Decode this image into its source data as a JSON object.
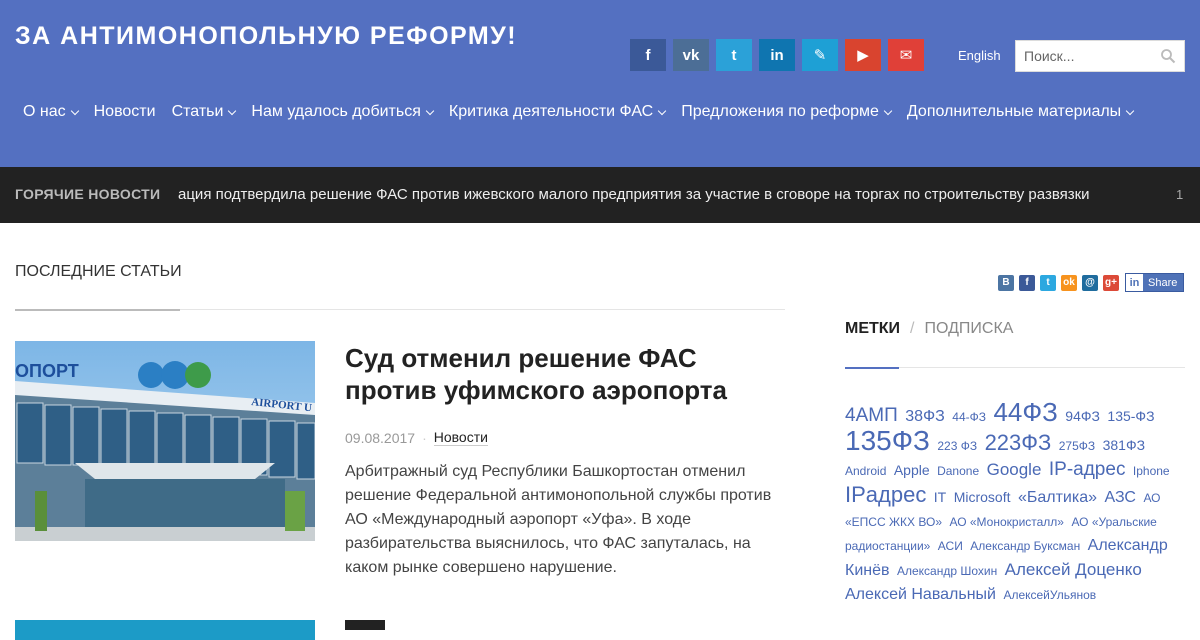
{
  "site": {
    "title": "ЗА АНТИМОНОПОЛЬНУЮ РЕФОРМУ!"
  },
  "social": [
    {
      "name": "facebook",
      "glyph": "f",
      "color": "#3b5998"
    },
    {
      "name": "vk",
      "glyph": "vk",
      "color": "#4c6e96"
    },
    {
      "name": "twitter",
      "glyph": "t",
      "color": "#2ba1d8"
    },
    {
      "name": "linkedin",
      "glyph": "in",
      "color": "#0f75b0"
    },
    {
      "name": "livejournal",
      "glyph": "✎",
      "color": "#1ea0d5"
    },
    {
      "name": "youtube",
      "glyph": "▶",
      "color": "#d9442f"
    },
    {
      "name": "email",
      "glyph": "✉",
      "color": "#e04038"
    }
  ],
  "header": {
    "lang": "English",
    "search_placeholder": "Поиск..."
  },
  "nav": [
    {
      "label": "О нас",
      "dropdown": true
    },
    {
      "label": "Новости",
      "dropdown": false
    },
    {
      "label": "Статьи",
      "dropdown": true
    },
    {
      "label": "Нам удалось добиться",
      "dropdown": true
    },
    {
      "label": "Критика деятельности ФАС",
      "dropdown": true
    },
    {
      "label": "Предложения по реформе",
      "dropdown": true
    },
    {
      "label": "Дополнительные материалы",
      "dropdown": true
    }
  ],
  "ticker": {
    "label": "ГОРЯЧИЕ НОВОСТИ",
    "text": "ация подтвердила решение ФАС против ижевского малого предприятия за участие в сговоре на торгах по строительству развязки",
    "next": "1"
  },
  "main": {
    "section_title": "ПОСЛЕДНИЕ СТАТЬИ",
    "share_label": "Share",
    "share_icons": [
      {
        "name": "vk",
        "glyph": "В",
        "color": "#4c75a3"
      },
      {
        "name": "facebook",
        "glyph": "f",
        "color": "#3b5998"
      },
      {
        "name": "twitter",
        "glyph": "t",
        "color": "#2ca8e0"
      },
      {
        "name": "odnoklassniki",
        "glyph": "ok",
        "color": "#f7931e"
      },
      {
        "name": "mailru",
        "glyph": "@",
        "color": "#1f6c9e"
      },
      {
        "name": "googleplus",
        "glyph": "g+",
        "color": "#dc4a38"
      }
    ],
    "article": {
      "title": "Суд отменил решение ФАС против уфимского аэропорта",
      "date": "09.08.2017",
      "category": "Новости",
      "excerpt": "Арбитражный суд Республики Башкортостан отменил решение Федеральной антимонопольной службы против АО «Международный аэропорт «Уфа». В ходе разбирательства выяснилось, что ФАС запуталась, на каком рынке совершено нарушение.",
      "image_text_left": "ОПОРТ",
      "image_text_right": "AIRPORT U"
    }
  },
  "sidebar": {
    "tab_active": "МЕТКИ",
    "tab_sep": "/",
    "tab_inactive": "ПОДПИСКА",
    "tags": [
      {
        "text": "4АМП",
        "size": "t19"
      },
      {
        "text": "38ФЗ",
        "size": "t16"
      },
      {
        "text": "44-ФЗ",
        "size": "t12"
      },
      {
        "text": "44ФЗ",
        "size": "t26"
      },
      {
        "text": "94ФЗ",
        "size": "t14"
      },
      {
        "text": "135-ФЗ",
        "size": "t14"
      },
      {
        "text": "135ФЗ",
        "size": "t28"
      },
      {
        "text": "223 ФЗ",
        "size": "t12"
      },
      {
        "text": "223ФЗ",
        "size": "t22"
      },
      {
        "text": "275ФЗ",
        "size": "t12"
      },
      {
        "text": "381ФЗ",
        "size": "t14"
      },
      {
        "text": "Android",
        "size": "t12"
      },
      {
        "text": "Apple",
        "size": "t14"
      },
      {
        "text": "Danone",
        "size": "t12"
      },
      {
        "text": "Google",
        "size": "t17"
      },
      {
        "text": "IP-адрес",
        "size": "t19"
      },
      {
        "text": "Iphone",
        "size": "t12"
      },
      {
        "text": "IPадрес",
        "size": "t22"
      },
      {
        "text": "IT",
        "size": "t14"
      },
      {
        "text": "Microsoft",
        "size": "t14"
      },
      {
        "text": "«Балтика»",
        "size": "t16"
      },
      {
        "text": "АЗС",
        "size": "t16"
      },
      {
        "text": "АО «ЕПСС ЖКХ ВО»",
        "size": "t12"
      },
      {
        "text": "АО «Монокристалл»",
        "size": "t12"
      },
      {
        "text": "АО «Уральские радиостанции»",
        "size": "t12"
      },
      {
        "text": "АСИ",
        "size": "t12"
      },
      {
        "text": "Александр Буксман",
        "size": "t12"
      },
      {
        "text": "Александр Кинёв",
        "size": "t16"
      },
      {
        "text": "Александр Шохин",
        "size": "t12"
      },
      {
        "text": "Алексей Доценко",
        "size": "t17"
      },
      {
        "text": "Алексей Навальный",
        "size": "t16"
      },
      {
        "text": "АлексейУльянов",
        "size": "t12"
      }
    ]
  }
}
